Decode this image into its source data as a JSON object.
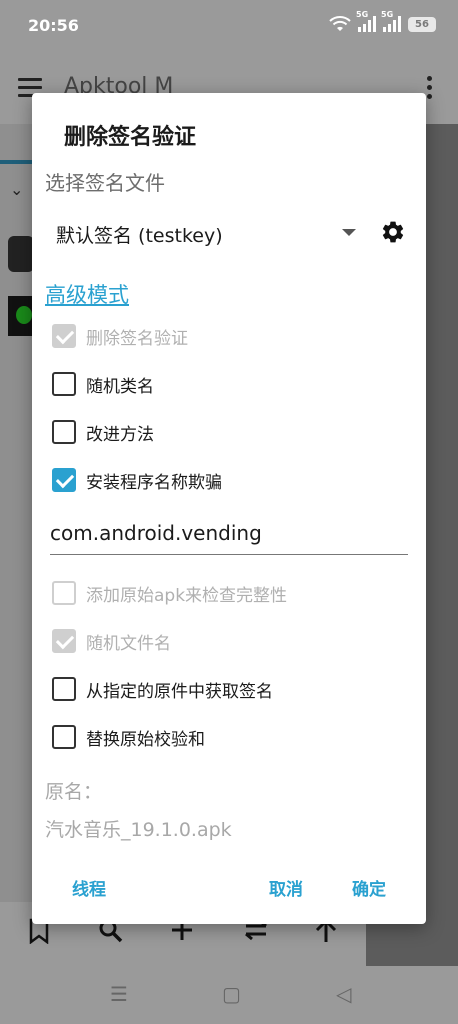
{
  "statusbar": {
    "time": "20:56",
    "signal1": "5G",
    "signal2": "5G",
    "battery": "56",
    "icons": [
      "wifi-icon",
      "signal-icon",
      "signal-icon",
      "battery-icon"
    ]
  },
  "app": {
    "title": "Apktool M",
    "bottom_icons": [
      "bookmark-icon",
      "search-icon",
      "add-icon",
      "swap-icon",
      "upload-icon"
    ],
    "nav_icons": [
      "menu-nav-icon",
      "home-nav-icon",
      "back-nav-icon"
    ]
  },
  "dialog": {
    "title": "删除签名验证",
    "signature_section_label": "选择签名文件",
    "signature_selected": "默认签名 (testkey)",
    "advanced_mode_link": "高级模式",
    "options": [
      {
        "label": "删除签名验证",
        "checked": true,
        "enabled": false
      },
      {
        "label": "随机类名",
        "checked": false,
        "enabled": true
      },
      {
        "label": "改进方法",
        "checked": false,
        "enabled": true
      },
      {
        "label": "安装程序名称欺骗",
        "checked": true,
        "enabled": true
      }
    ],
    "installer_package_value": "com.android.vending",
    "options2": [
      {
        "label": "添加原始apk来检查完整性",
        "checked": false,
        "enabled": false
      },
      {
        "label": "随机文件名",
        "checked": true,
        "enabled": false
      },
      {
        "label": "从指定的原件中获取签名",
        "checked": false,
        "enabled": true
      },
      {
        "label": "替换原始校验和",
        "checked": false,
        "enabled": true
      }
    ],
    "original_name_label": "原名：",
    "original_name_value": "汽水音乐_19.1.0.apk",
    "buttons": {
      "thread": "线程",
      "cancel": "取消",
      "ok": "确定"
    },
    "accent_color": "#2aa1d0"
  }
}
